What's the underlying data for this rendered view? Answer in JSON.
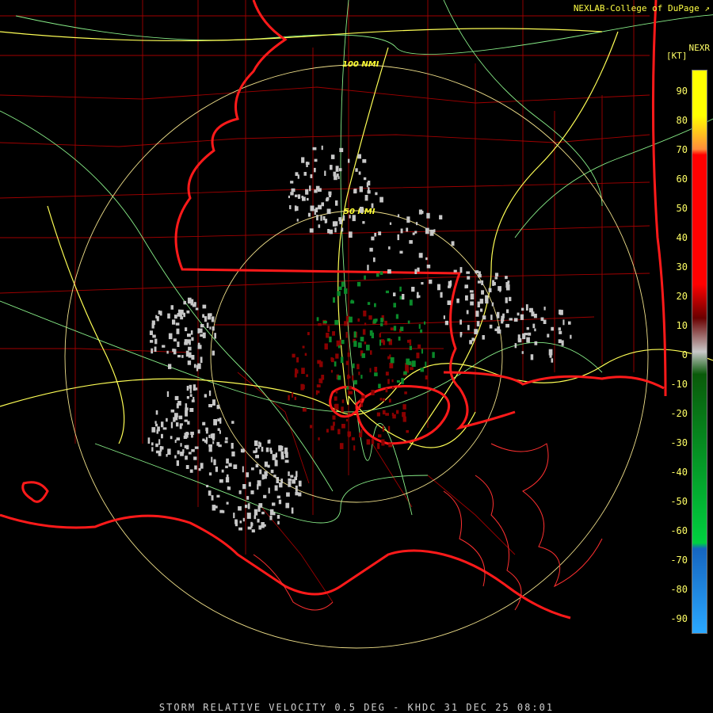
{
  "header": {
    "credit": "NEXLAB-College of DuPage ↗",
    "product": "NEXR",
    "units": "[KT]"
  },
  "footer": {
    "caption": "STORM RELATIVE VELOCITY 0.5 DEG - KHDC 31 DEC 25 08:01"
  },
  "range_rings": [
    {
      "label": "100 NMI"
    },
    {
      "label": "50 NMI"
    }
  ],
  "legend": {
    "ticks": [
      "90",
      "80",
      "70",
      "60",
      "50",
      "40",
      "30",
      "20",
      "10",
      "0",
      "-10",
      "-20",
      "-30",
      "-40",
      "-50",
      "-60",
      "-70",
      "-80",
      "-90"
    ],
    "colors": {
      "positive_high": "#ffff00",
      "positive_mid": "#ff8c3a",
      "positive_red": "#ff0000",
      "positive_dark": "#6a0000",
      "zero": "#c8c8c8",
      "negative_dark": "#0a5a0a",
      "negative_green": "#00d040",
      "negative_blue": "#1565c0",
      "negative_light": "#2aa8ff"
    }
  },
  "map_colors": {
    "state_boundaries": "#ff1a1a",
    "county_boundaries": "#b80000",
    "interstates": "#ffff55",
    "highways": "#88ee88",
    "range_rings": "#f0e08a"
  }
}
